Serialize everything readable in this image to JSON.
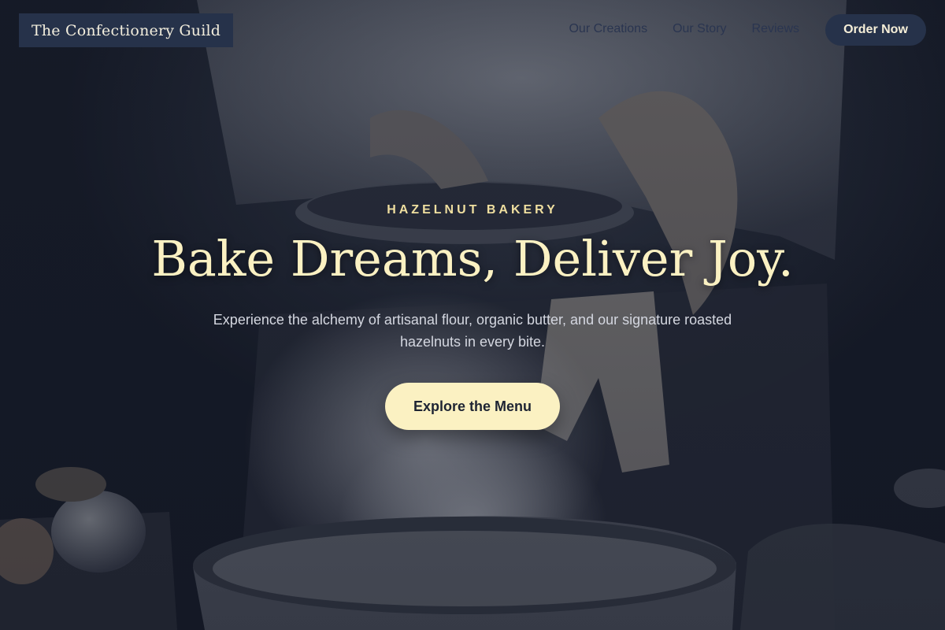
{
  "brand": {
    "name": "The Confectionery Guild"
  },
  "nav": {
    "links": [
      "Our Creations",
      "Our Story",
      "Reviews"
    ],
    "cta_label": "Order Now"
  },
  "hero": {
    "eyebrow": "HAZELNUT BAKERY",
    "headline": "Bake Dreams, Deliver Joy.",
    "subtitle": "Experience the alchemy of artisanal flour, organic butter, and our signature roasted hazelnuts in every bite.",
    "cta_label": "Explore the Menu"
  },
  "colors": {
    "navy": "#26324a",
    "cream": "#fbf1c2",
    "gold": "#f0dfa0",
    "background": "#151a27"
  }
}
